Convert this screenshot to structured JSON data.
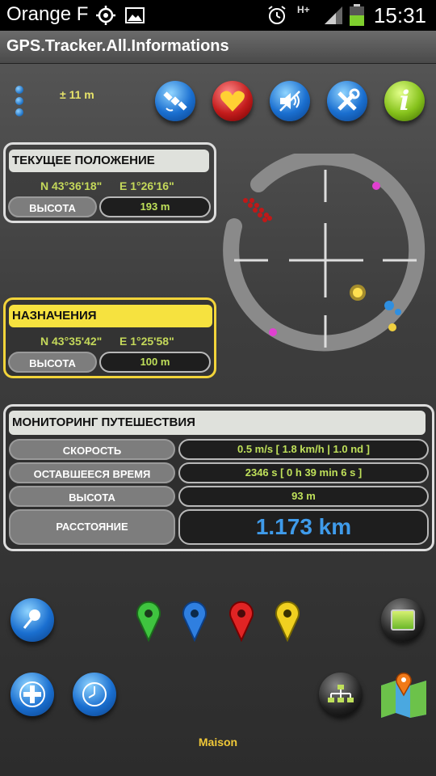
{
  "status_bar": {
    "carrier": "Orange F",
    "network": "H+",
    "time": "15:31",
    "icons": [
      "gps-icon",
      "image-icon",
      "alarm-icon",
      "network-h-plus-icon",
      "signal-icon",
      "battery-icon"
    ]
  },
  "app": {
    "title": "GPS.Tracker.All.Informations"
  },
  "toolbar": {
    "accuracy": "± 11 m",
    "buttons": [
      "satellite-button",
      "favorites-button",
      "sound-button",
      "settings-button",
      "info-button"
    ]
  },
  "current": {
    "title": "ТЕКУЩЕЕ ПОЛОЖЕНИЕ",
    "lat": "N 43°36'18\"",
    "lon": "E 1°26'16\"",
    "alt_label": "ВЫСОТА",
    "alt_value": "193 m"
  },
  "destination": {
    "title": "НАЗНАЧЕНИЯ",
    "lat": "N 43°35'42\"",
    "lon": "E 1°25'58\"",
    "alt_label": "ВЫСОТА",
    "alt_value": "100 m"
  },
  "monitor": {
    "title": "МОНИТОРИНГ ПУТЕШЕСТВИЯ",
    "rows": [
      {
        "label": "СКОРОСТЬ",
        "value": "0.5 m/s  [ 1.8 km/h  |  1.0 nd ]"
      },
      {
        "label": "ОСТАВШЕЕСЯ ВРЕМЯ",
        "value": "2346 s  [ 0 h 39 min 6 s ]"
      },
      {
        "label": "ВЫСОТА",
        "value": "93 m"
      },
      {
        "label": "РАССТОЯНИЕ",
        "value": "1.173 km"
      }
    ]
  },
  "markers": [
    "green",
    "blue",
    "red",
    "yellow"
  ],
  "footer": {
    "place": "Maison"
  },
  "colors": {
    "accent_yellow": "#f6e23f",
    "value_green": "#bfe05a",
    "distance_blue": "#3f9bea"
  }
}
